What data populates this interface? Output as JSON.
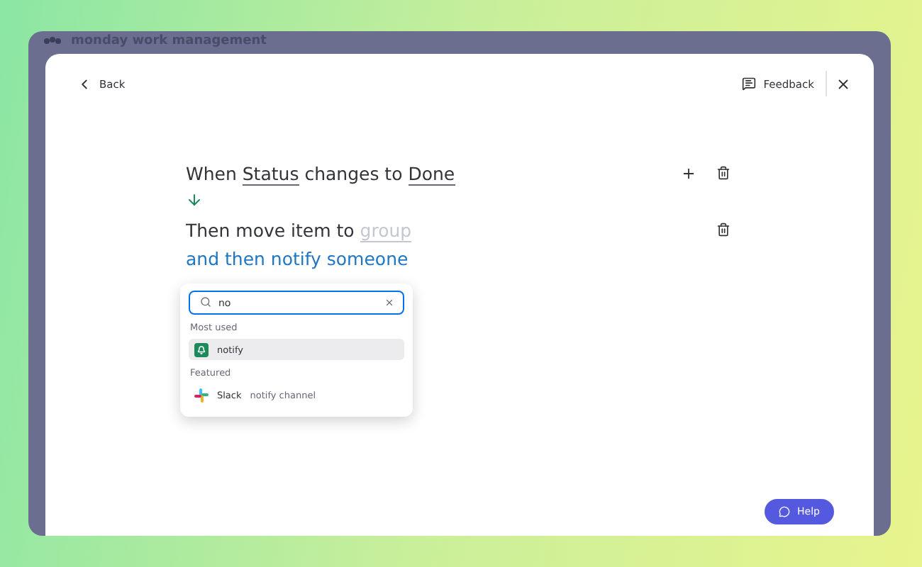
{
  "app_header": {
    "brand": "monday work management"
  },
  "top_bar": {
    "back": "Back",
    "feedback": "Feedback"
  },
  "trigger": {
    "parts": [
      {
        "text": "When ",
        "kind": "plain"
      },
      {
        "text": "Status",
        "kind": "field"
      },
      {
        "text": " changes to ",
        "kind": "plain"
      },
      {
        "text": "Done",
        "kind": "field"
      }
    ]
  },
  "action": {
    "parts": [
      {
        "text": "Then move item to ",
        "kind": "plain"
      },
      {
        "text": "group",
        "kind": "placeholder"
      }
    ]
  },
  "add_action": "and then notify someone",
  "search": {
    "value": "no"
  },
  "sections": [
    {
      "title": "Most used",
      "items": [
        {
          "label": "notify",
          "selected": true,
          "kind": "notify"
        }
      ]
    },
    {
      "title": "Featured",
      "items": [
        {
          "label": "Slack",
          "detail": "notify channel",
          "selected": false,
          "kind": "slack"
        }
      ]
    }
  ],
  "help": "Help"
}
